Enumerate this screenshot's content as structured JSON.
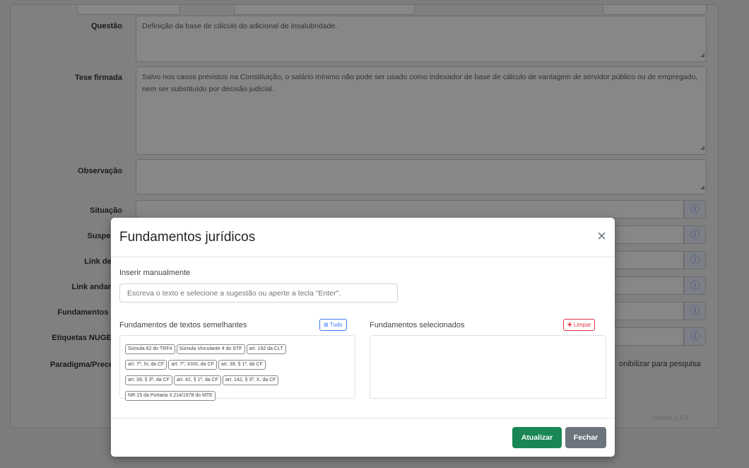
{
  "form": {
    "fields": {
      "questao_label": "Questão",
      "questao_value": "Definição da base de cálculo do adicional de insalubridade.",
      "tese_label": "Tese firmada",
      "tese_value": "Salvo nos casos previstos na Constituição, o salário mínimo não pode ser usado como indexador de base de cálculo de vantagem de servidor público ou de empregado, nem ser substituído por decisão judicial.",
      "observacao_label": "Observação",
      "situacao_label": "Situação",
      "suspensao_label": "Suspens:",
      "link_decisao_label": "Link decis",
      "link_andamento_label": "Link andamer",
      "fundamentos_label": "Fundamentos log",
      "etiquetas_label": "Etiquetas NUGEPN",
      "paradigma_label": "Paradigma/Precede"
    },
    "checkbox_text": "onibilizar para pesquisa",
    "info_icon": "ⓘ",
    "version": "versão 1.2.3"
  },
  "modal": {
    "title": "Fundamentos jurídicos",
    "close_icon": "×",
    "manual_label": "Inserir manualmente",
    "manual_placeholder": "Escreva o texto e selecione a sugestão ou aperte a tecla \"Enter\".",
    "similar_label": "Fundamentos de textos semelhantes",
    "tudo_button": "⊞ Tudo",
    "selected_label": "Fundamentos selecionados",
    "limpar_button": "✚ Limpar",
    "chips": [
      "Súmula 62 do TRF4",
      "Súmula Vinculante 4 do STF",
      "art. 192 da CLT",
      "art. 7º, IV, da CF",
      "art. 7º, XXIII, da CF",
      "art. 39, § 1º, da CF",
      "art. 39, § 3º, da CF",
      "art. 42, § 1º, da CF",
      "art. 142, § 3º, X, da CF",
      "NR-15 da Portaria 3.214/1978 do MTE"
    ],
    "atualizar_button": "Atualizar",
    "fechar_button": "Fechar"
  },
  "colors": {
    "overlay": "#7d7d7d",
    "success": "#198754",
    "secondary": "#6c757d",
    "primary": "#3d7bf5",
    "danger": "#dc3545"
  }
}
